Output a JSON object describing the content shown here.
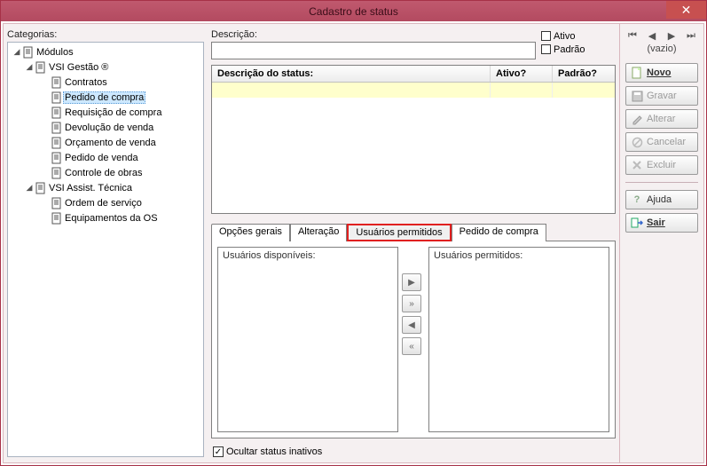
{
  "window": {
    "title": "Cadastro de status"
  },
  "left": {
    "label": "Categorias:",
    "tree": {
      "root": "Módulos",
      "group1": "VSI Gestão ®",
      "items1": [
        "Contratos",
        "Pedido de compra",
        "Requisição de compra",
        "Devolução de venda",
        "Orçamento de venda",
        "Pedido de venda",
        "Controle de obras"
      ],
      "group2": "VSI Assist. Técnica",
      "items2": [
        "Ordem de serviço",
        "Equipamentos da OS"
      ]
    }
  },
  "mid": {
    "desc_label": "Descrição:",
    "checks": {
      "ativo": "Ativo",
      "padrao": "Padrão"
    },
    "grid_headers": {
      "c1": "Descrição do status:",
      "c2": "Ativo?",
      "c3": "Padrão?"
    },
    "tabs": [
      "Opções gerais",
      "Alteração",
      "Usuários permitidos",
      "Pedido de compra"
    ],
    "lists": {
      "available": "Usuários disponíveis:",
      "allowed": "Usuários permitidos:"
    },
    "hide_inactive": "Ocultar status inativos"
  },
  "right": {
    "nav_status": "(vazio)",
    "buttons": {
      "novo": "Novo",
      "gravar": "Gravar",
      "alterar": "Alterar",
      "cancelar": "Cancelar",
      "excluir": "Excluir",
      "ajuda": "Ajuda",
      "sair": "Sair"
    }
  }
}
